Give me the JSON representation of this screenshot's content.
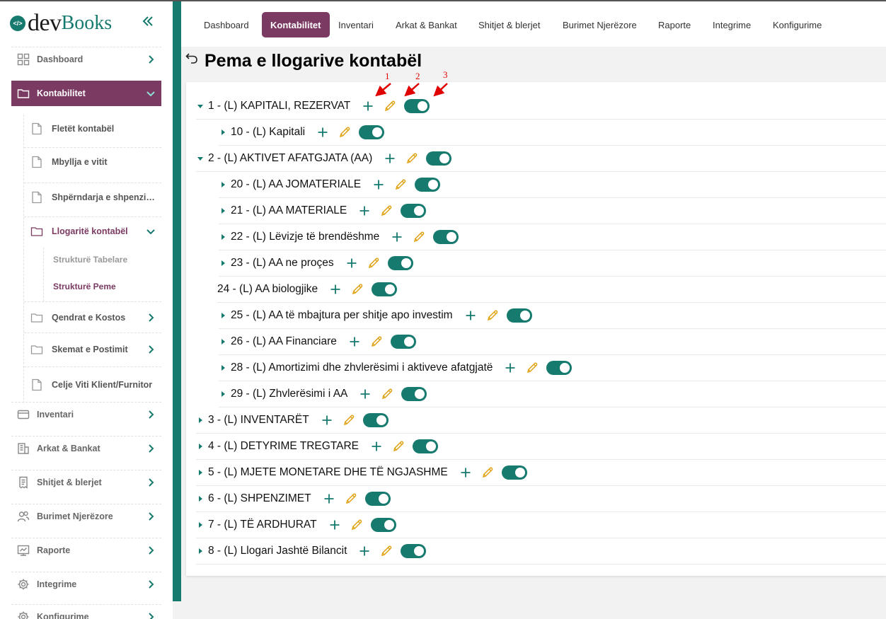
{
  "colors": {
    "brand": "#167a6e",
    "accent": "#7b3a62",
    "edit": "#e0a418",
    "annotation": "#e00000"
  },
  "logo": {
    "mark": "</>",
    "dev": "dev",
    "books": "Books"
  },
  "sidebar": {
    "collapse_icon": "double-chevron-left-icon",
    "items": [
      {
        "label": "Dashboard",
        "icon": "grid-icon"
      },
      {
        "label": "Kontabilitet",
        "icon": "folder-icon"
      },
      {
        "label": "Inventari",
        "icon": "card-icon"
      },
      {
        "label": "Arkat & Bankat",
        "icon": "building-icon"
      },
      {
        "label": "Shitjet & blerjet",
        "icon": "receipt-icon"
      },
      {
        "label": "Burimet Njerëzore",
        "icon": "users-icon"
      },
      {
        "label": "Raporte",
        "icon": "report-icon"
      },
      {
        "label": "Integrime",
        "icon": "gear-icon"
      },
      {
        "label": "Konfigurime",
        "icon": "gear-icon"
      }
    ],
    "sub_items": [
      {
        "label": "Fletët kontabël",
        "icon": "file-icon"
      },
      {
        "label": "Mbyllja e vitit",
        "icon": "file-icon"
      },
      {
        "label": "Shpërndarja e shpenzimeve",
        "icon": "file-icon"
      },
      {
        "label": "Llogaritë kontabël",
        "icon": "folder-icon"
      },
      {
        "label": "Qendrat e Kostos",
        "icon": "folder-icon"
      },
      {
        "label": "Skemat e Postimit",
        "icon": "folder-icon"
      },
      {
        "label": "Celje Viti Klient/Furnitor",
        "icon": "file-icon"
      }
    ],
    "subsub_items": [
      {
        "label": "Strukturë Tabelare"
      },
      {
        "label": "Strukturë Peme"
      }
    ]
  },
  "topnav": {
    "tabs": [
      {
        "label": "Dashboard"
      },
      {
        "label": "Kontabilitet"
      },
      {
        "label": "Inventari"
      },
      {
        "label": "Arkat & Bankat"
      },
      {
        "label": "Shitjet & blerjet"
      },
      {
        "label": "Burimet Njerëzore"
      },
      {
        "label": "Raporte"
      },
      {
        "label": "Integrime"
      },
      {
        "label": "Konfigurime"
      }
    ],
    "active": "Kontabilitet"
  },
  "page": {
    "title": "Pema e llogarive kontabël",
    "back_icon": "undo-arrow-icon"
  },
  "tree": [
    {
      "label": "1 - (L) KAPITALI, REZERVAT",
      "level": 0,
      "state": "expanded",
      "enabled": true
    },
    {
      "label": "10 - (L) Kapitali",
      "level": 1,
      "state": "collapsed",
      "enabled": true
    },
    {
      "label": "2 - (L) AKTIVET AFATGJATA (AA)",
      "level": 0,
      "state": "expanded",
      "enabled": true
    },
    {
      "label": "20 - (L) AA JOMATERIALE",
      "level": 1,
      "state": "collapsed",
      "enabled": true
    },
    {
      "label": "21 - (L) AA MATERIALE",
      "level": 1,
      "state": "collapsed",
      "enabled": true
    },
    {
      "label": "22 - (L) Lëvizje të brendëshme",
      "level": 1,
      "state": "collapsed",
      "enabled": true
    },
    {
      "label": "23 - (L) AA ne proçes",
      "level": 1,
      "state": "collapsed",
      "enabled": true
    },
    {
      "label": "24 - (L) AA biologjike",
      "level": 1,
      "state": "leaf",
      "enabled": true
    },
    {
      "label": "25 - (L) AA të mbajtura per shitje apo investim",
      "level": 1,
      "state": "collapsed",
      "enabled": true
    },
    {
      "label": "26 - (L) AA Financiare",
      "level": 1,
      "state": "collapsed",
      "enabled": true
    },
    {
      "label": "28 - (L) Amortizimi dhe zhvlerësimi i aktiveve afatgjatë",
      "level": 1,
      "state": "collapsed",
      "enabled": true
    },
    {
      "label": "29 - (L) Zhvlerësimi i AA",
      "level": 1,
      "state": "collapsed",
      "enabled": true
    },
    {
      "label": "3 - (L) INVENTARËT",
      "level": 0,
      "state": "collapsed",
      "enabled": true
    },
    {
      "label": "4 - (L) DETYRIME TREGTARE",
      "level": 0,
      "state": "collapsed",
      "enabled": true
    },
    {
      "label": "5 - (L) MJETE MONETARE DHE TË NGJASHME",
      "level": 0,
      "state": "collapsed",
      "enabled": true
    },
    {
      "label": "6 - (L) SHPENZIMET",
      "level": 0,
      "state": "collapsed",
      "enabled": true
    },
    {
      "label": "7 - (L) TË ARDHURAT",
      "level": 0,
      "state": "collapsed",
      "enabled": true
    },
    {
      "label": "8 - (L) Llogari Jashtë Bilancit",
      "level": 0,
      "state": "collapsed",
      "enabled": true
    }
  ],
  "row_icons": {
    "add": "plus-icon",
    "edit": "pencil-icon",
    "toggle": "toggle-switch"
  },
  "annotations": [
    "1",
    "2",
    "3"
  ]
}
